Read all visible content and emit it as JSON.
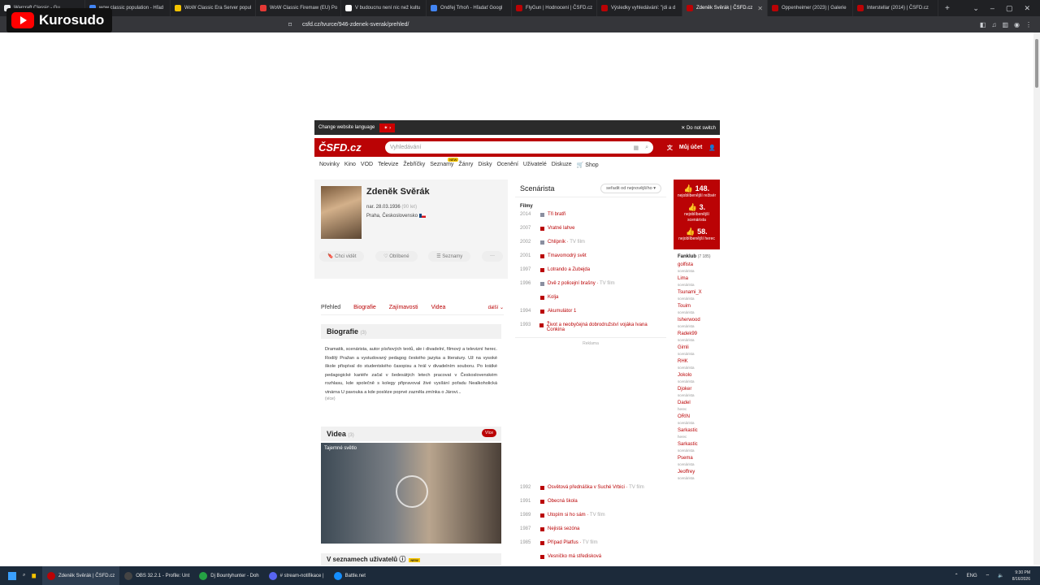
{
  "browser": {
    "tabs": [
      {
        "label": "Warcraft Classic - Gu",
        "color": "#e8eaed"
      },
      {
        "label": "wow classic population - Hľad",
        "color": "#4285f4"
      },
      {
        "label": "WoW Classic Era Server popul",
        "color": "#f5c400"
      },
      {
        "label": "WoW Classic Firemaw (EU) Po",
        "color": "#e53935"
      },
      {
        "label": "V budoucnu není nic než kultu",
        "color": "#ffffff"
      },
      {
        "label": "Ondřej Trhoň - Hľadať Googl",
        "color": "#4285f4"
      },
      {
        "label": "FlyGun | Hodnocení | ČSFD.cz",
        "color": "#ba0305"
      },
      {
        "label": "Výsledky vyhledávání: \"jdi a d",
        "color": "#ba0305"
      },
      {
        "label": "Zdeněk Svěrák | ČSFD.cz",
        "color": "#ba0305",
        "active": true
      },
      {
        "label": "Oppenheimer (2023) | Galerie",
        "color": "#ba0305"
      },
      {
        "label": "Interstellar (2014) | ČSFD.cz",
        "color": "#ba0305"
      }
    ],
    "url": "csfd.cz/tvurce/946-zdenek-sverak/prehled/",
    "new_tab": "+"
  },
  "overlay": {
    "channel": "Kurosudo"
  },
  "langbar": {
    "text": "Change website language",
    "flag": "✶ ›",
    "noswitch": "✕ Do not switch"
  },
  "header": {
    "logo": "ČSFD.cz",
    "search_placeholder": "Vyhledávání",
    "account": "Můj účet"
  },
  "menu": [
    "Novinky",
    "Kino",
    "VOD",
    "Televize",
    "Žebříčky",
    "Seznamy",
    "Žánry",
    "Disky",
    "Ocenění",
    "Uživatelé",
    "Diskuze",
    "🛒 Shop"
  ],
  "menu_badge": "NEW",
  "profile": {
    "name": "Zdeněk Svěrák",
    "born": "nar. 28.03.1936",
    "age": "(90 let)",
    "place": "Praha, Československo",
    "actions": [
      "🔖 Chci vidět",
      "♡ Oblíbené",
      "☰ Seznamy",
      "···"
    ]
  },
  "subtabs": {
    "items": [
      "Přehled",
      "Biografie",
      "Zajímavosti",
      "Videa"
    ],
    "more": "další ⌄"
  },
  "bio": {
    "title": "Biografie",
    "count": "(3)",
    "text": "Dramatik, scenárista, autor písňových textů, ale i divadelní, filmový a televizní herec. Rodilý Pražan a vystudovaný pedagog českého jazyka a literatury. Už na vysoké škole přispíval do studentského časopisu a hrál v divadelním souboru. Po krátké pedagogické kariéře začal v šedesátých letech pracovat v Československém rozhlasu, kde společně s kolegy připravoval živé vysílání pořadu Nealkoholická vinárna U pavouka a kde posléze poprvé zazněla zmínka o Járovi...",
    "more": "(více)"
  },
  "videos": {
    "title": "Videa",
    "count": "(3)",
    "button": "Více",
    "caption": "Tajemné světlo"
  },
  "lists": {
    "title": "V seznamech uživatelů",
    "badge": "NEW"
  },
  "filmography": {
    "role": "Scenárista",
    "sort": "seřadit od nejnovějšího",
    "section": "Filmy",
    "rows_top": [
      {
        "year": "2014",
        "title": "Tři bratři",
        "note": "",
        "color": "#8a8fa0"
      },
      {
        "year": "2007",
        "title": "Vratné lahve",
        "note": "",
        "color": "#ba0305"
      },
      {
        "year": "2002",
        "title": "Chlípník",
        "note": "TV film",
        "color": "#8a8fa0"
      },
      {
        "year": "2001",
        "title": "Tmavomodrý svět",
        "note": "",
        "color": "#ba0305"
      },
      {
        "year": "1997",
        "title": "Lotrando a Zubejda",
        "note": "",
        "color": "#ba0305"
      },
      {
        "year": "1996",
        "title": "Dvě z policejní brašny",
        "note": "TV film",
        "color": "#8a8fa0"
      },
      {
        "year": "",
        "title": "Kolja",
        "note": "",
        "color": "#ba0305"
      },
      {
        "year": "1994",
        "title": "Akumulátor 1",
        "note": "",
        "color": "#ba0305"
      },
      {
        "year": "1993",
        "title": "Život a neobyčejná dobrodružství vojáka Ivana Čonkina",
        "note": "",
        "color": "#ba0305"
      }
    ],
    "reklama": "Reklama",
    "rows_bottom": [
      {
        "year": "1992",
        "title": "Osvětová přednáška v Suché Vrbici",
        "note": "TV film",
        "color": "#ba0305"
      },
      {
        "year": "1991",
        "title": "Obecná škola",
        "note": "",
        "color": "#ba0305"
      },
      {
        "year": "1989",
        "title": "Utopím si ho sám",
        "note": "TV film",
        "color": "#ba0305"
      },
      {
        "year": "1987",
        "title": "Nejistá sezóna",
        "note": "",
        "color": "#ba0305"
      },
      {
        "year": "1985",
        "title": "Případ Platfus",
        "note": "TV film",
        "color": "#ba0305"
      },
      {
        "year": "",
        "title": "Vesničko má středisková",
        "note": "",
        "color": "#ba0305"
      }
    ]
  },
  "rankings": [
    {
      "num": "👍 148.",
      "label": "nejoblíbenější režisér"
    },
    {
      "num": "👍 3.",
      "label": "nejoblíbenější scenárista"
    },
    {
      "num": "👍 58.",
      "label": "nejoblíbenější herec"
    }
  ],
  "fanklub": {
    "title": "Fanklub",
    "count": "(7 185)",
    "members": [
      {
        "u": "golfista",
        "r": "scenárista"
      },
      {
        "u": "Lima",
        "r": "scenárista"
      },
      {
        "u": "Tsunami_X",
        "r": "scenárista"
      },
      {
        "u": "Touim",
        "r": "scenárista"
      },
      {
        "u": "Isherwood",
        "r": "scenárista"
      },
      {
        "u": "Radek99",
        "r": "scenárista"
      },
      {
        "u": "Gimli",
        "r": "scenárista"
      },
      {
        "u": "RHK",
        "r": "scenárista"
      },
      {
        "u": "Jokolo",
        "r": "scenárista"
      },
      {
        "u": "Djoker",
        "r": "scenárista"
      },
      {
        "u": "Dadel",
        "r": "herec"
      },
      {
        "u": "ORIN",
        "r": "scenárista"
      },
      {
        "u": "Sarkastic",
        "r": "herec"
      },
      {
        "u": "Sarkastic",
        "r": "scenárista"
      },
      {
        "u": "Psema",
        "r": "scenárista"
      },
      {
        "u": "Jeoffrey",
        "r": "scenárista"
      }
    ]
  },
  "taskbar": {
    "apps": [
      {
        "label": "Zdeněk Svěrák | ČSFD.cz",
        "color": "#ba0305"
      },
      {
        "label": "OBS 32.2.1 - Profile: Unt",
        "color": "#444"
      },
      {
        "label": "Dj Bountyhunter - Doh",
        "color": "#25a244"
      },
      {
        "label": "# stream-notifikace |",
        "color": "#5865f2"
      },
      {
        "label": "Battle.net",
        "color": "#148eff"
      }
    ],
    "lang": "ENG",
    "time": "9:30 PM",
    "date": "8/16/2026"
  }
}
